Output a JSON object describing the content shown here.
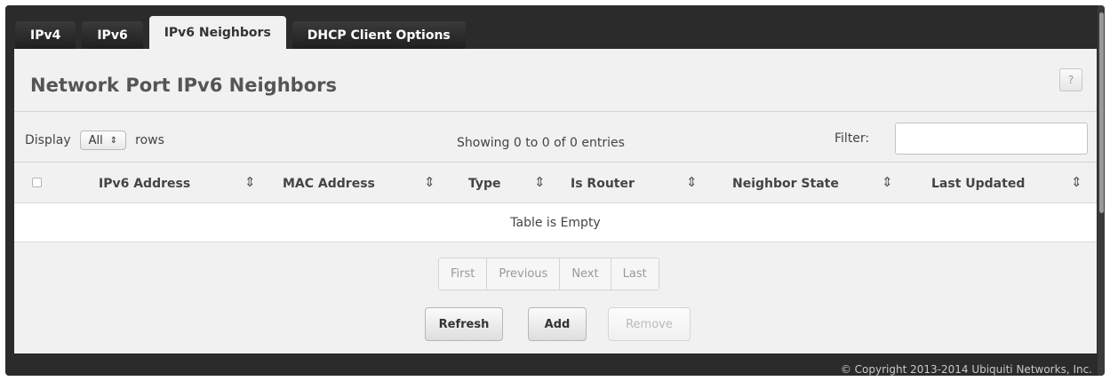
{
  "tabs": [
    {
      "label": "IPv4"
    },
    {
      "label": "IPv6"
    },
    {
      "label": "IPv6 Neighbors"
    },
    {
      "label": "DHCP Client Options"
    }
  ],
  "active_tab": "IPv6 Neighbors",
  "page": {
    "title": "Network Port IPv6 Neighbors",
    "help_label": "?"
  },
  "controls": {
    "display_label": "Display",
    "rows_select_value": "All",
    "rows_label": "rows",
    "showing_text": "Showing 0 to 0 of 0 entries",
    "filter_label": "Filter:",
    "filter_value": ""
  },
  "table": {
    "columns": [
      "IPv6 Address",
      "MAC Address",
      "Type",
      "Is Router",
      "Neighbor State",
      "Last Updated"
    ],
    "empty_text": "Table is Empty"
  },
  "pagination": {
    "first": "First",
    "previous": "Previous",
    "next": "Next",
    "last": "Last"
  },
  "actions": {
    "refresh": "Refresh",
    "add": "Add",
    "remove": "Remove"
  },
  "footer": {
    "copyright": "© Copyright 2013-2014 Ubiquiti Networks, Inc."
  },
  "icons": {
    "sort": "sort-arrows-icon",
    "select_arrow": "select-updown-icon",
    "help": "help-icon"
  },
  "colors": {
    "frame": "#2b2b2b",
    "panel": "#f1f1f1",
    "tab_active_bg": "#f1f1f1",
    "tab_inactive_bg": "#2a2a2a"
  }
}
